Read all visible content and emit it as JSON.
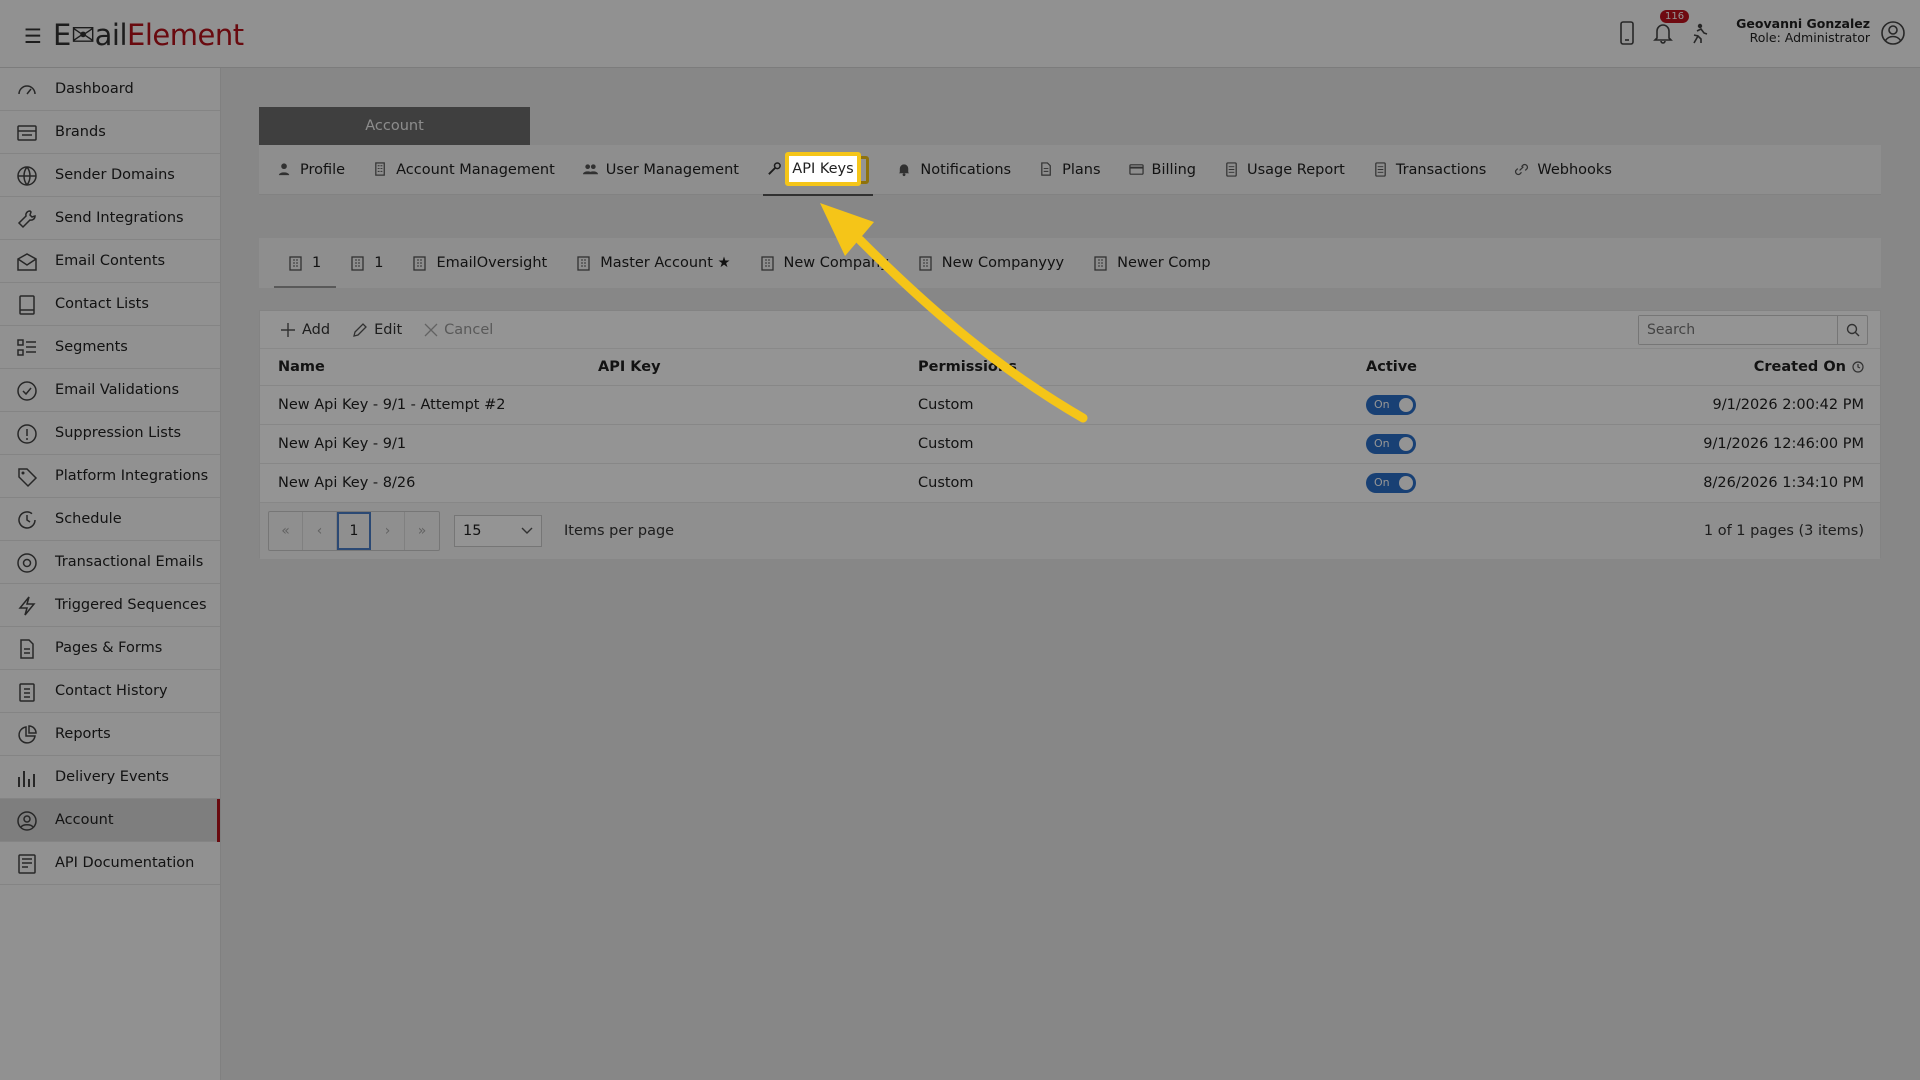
{
  "header": {
    "logo_part1": "E",
    "logo_part2": "ail",
    "logo_part3": "Element",
    "notification_count": "116",
    "user_name": "Geovanni Gonzalez",
    "user_role": "Role: Administrator"
  },
  "sidebar": {
    "items": [
      {
        "label": "Dashboard",
        "icon": "dashboard-icon"
      },
      {
        "label": "Brands",
        "icon": "brands-icon"
      },
      {
        "label": "Sender Domains",
        "icon": "globe-icon"
      },
      {
        "label": "Send Integrations",
        "icon": "wrench-icon"
      },
      {
        "label": "Email Contents",
        "icon": "envelope-icon"
      },
      {
        "label": "Contact Lists",
        "icon": "book-icon"
      },
      {
        "label": "Segments",
        "icon": "segments-icon"
      },
      {
        "label": "Email Validations",
        "icon": "check-circle-icon"
      },
      {
        "label": "Suppression Lists",
        "icon": "exclamation-circle-icon"
      },
      {
        "label": "Platform Integrations",
        "icon": "tag-icon"
      },
      {
        "label": "Schedule",
        "icon": "clock-icon"
      },
      {
        "label": "Transactional Emails",
        "icon": "at-icon"
      },
      {
        "label": "Triggered Sequences",
        "icon": "bolt-icon"
      },
      {
        "label": "Pages & Forms",
        "icon": "file-icon"
      },
      {
        "label": "Contact History",
        "icon": "clipboard-icon"
      },
      {
        "label": "Reports",
        "icon": "pie-chart-icon"
      },
      {
        "label": "Delivery Events",
        "icon": "bar-chart-icon"
      },
      {
        "label": "Account",
        "icon": "user-circle-icon"
      },
      {
        "label": "API Documentation",
        "icon": "document-icon"
      }
    ]
  },
  "account_header": "Account",
  "tabs": [
    {
      "label": "Profile"
    },
    {
      "label": "Account Management"
    },
    {
      "label": "User Management"
    },
    {
      "label": "API Keys"
    },
    {
      "label": "Notifications"
    },
    {
      "label": "Plans"
    },
    {
      "label": "Billing"
    },
    {
      "label": "Usage Report"
    },
    {
      "label": "Transactions"
    },
    {
      "label": "Webhooks"
    }
  ],
  "subtabs": [
    {
      "label": "1"
    },
    {
      "label": "1"
    },
    {
      "label": "EmailOversight"
    },
    {
      "label": "Master Account ★"
    },
    {
      "label": "New Company"
    },
    {
      "label": "New Companyyy"
    },
    {
      "label": "Newer Comp"
    }
  ],
  "toolbar": {
    "add_label": "Add",
    "edit_label": "Edit",
    "cancel_label": "Cancel",
    "search_placeholder": "Search"
  },
  "table": {
    "headers": {
      "name": "Name",
      "api_key": "API Key",
      "permissions": "Permissions",
      "active": "Active",
      "created_on": "Created On"
    },
    "rows": [
      {
        "name": "New Api Key - 9/1 - Attempt #2",
        "api_key": "",
        "permissions": "Custom",
        "active": "On",
        "created_on": "9/1/2026 2:00:42 PM"
      },
      {
        "name": "New Api Key - 9/1",
        "api_key": "",
        "permissions": "Custom",
        "active": "On",
        "created_on": "9/1/2026 12:46:00 PM"
      },
      {
        "name": "New Api Key - 8/26",
        "api_key": "",
        "permissions": "Custom",
        "active": "On",
        "created_on": "8/26/2026 1:34:10 PM"
      }
    ]
  },
  "pager": {
    "first": "«",
    "prev": "‹",
    "current": "1",
    "next": "›",
    "last": "»",
    "page_size": "15",
    "items_per_page": "Items per page",
    "info": "1 of 1 pages (3 items)"
  },
  "colors": {
    "brand": "#b5121b",
    "highlight": "#f5c518",
    "toggle": "#2a6fc9"
  }
}
